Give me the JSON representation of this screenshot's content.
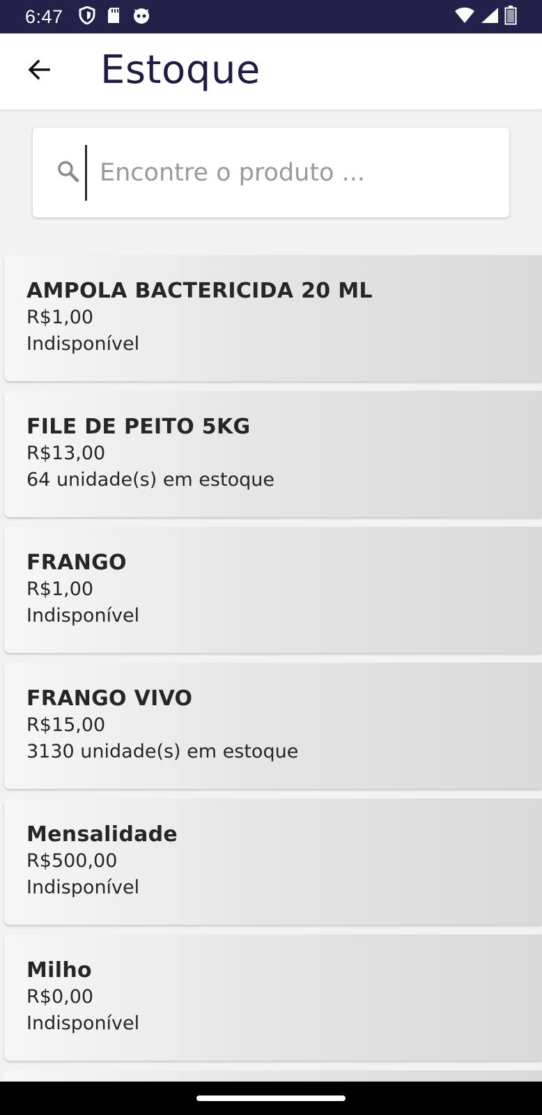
{
  "status_bar": {
    "time": "6:47",
    "left_icons": [
      "shield-icon",
      "sd-card-icon",
      "cat-icon"
    ],
    "right_icons": [
      "wifi-icon",
      "cell-signal-icon",
      "battery-icon"
    ]
  },
  "app_bar": {
    "back_icon": "arrow-left-icon",
    "title": "Estoque"
  },
  "search": {
    "icon": "search-icon",
    "placeholder": "Encontre o produto ...",
    "value": ""
  },
  "products": [
    {
      "name": "AMPOLA BACTERICIDA 20 ML",
      "price": "R$1,00",
      "stock": "Indisponível"
    },
    {
      "name": "FILE DE PEITO 5KG",
      "price": "R$13,00",
      "stock": "64 unidade(s) em estoque"
    },
    {
      "name": "FRANGO",
      "price": "R$1,00",
      "stock": "Indisponível"
    },
    {
      "name": "FRANGO VIVO",
      "price": "R$15,00",
      "stock": "3130 unidade(s) em estoque"
    },
    {
      "name": "Mensalidade",
      "price": "R$500,00",
      "stock": "Indisponível"
    },
    {
      "name": "Milho",
      "price": "R$0,00",
      "stock": "Indisponível"
    }
  ],
  "colors": {
    "status_bar": "#23204a",
    "title": "#1f1c45",
    "background": "#f2f2f2",
    "card_text": "#262626"
  }
}
